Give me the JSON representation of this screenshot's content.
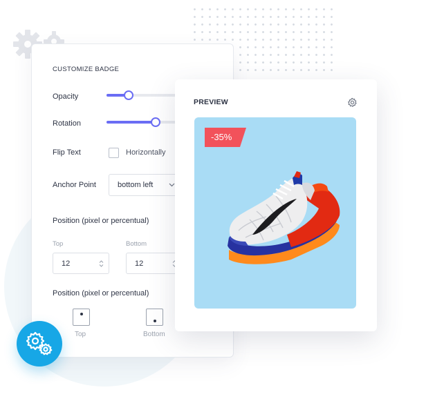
{
  "customize": {
    "title": "CUSTOMIZE BADGE",
    "opacity": {
      "label": "Opacity",
      "value": 0.23
    },
    "rotation": {
      "label": "Rotation",
      "value": 0.51
    },
    "flip_text": {
      "label": "Flip Text",
      "checkbox_label": "Horizontally",
      "checked": false
    },
    "anchor_point": {
      "label": "Anchor Point",
      "selected": "bottom left"
    },
    "position_offsets": {
      "heading": "Position (pixel or percentual)",
      "top": {
        "label": "Top",
        "value": "12"
      },
      "bottom": {
        "label": "Bottom",
        "value": "12"
      }
    },
    "position_buttons": {
      "heading": "Position (pixel or percentual)",
      "top_label": "Top",
      "bottom_label": "Bottom"
    }
  },
  "preview": {
    "title": "PREVIEW",
    "badge_text": "-35%",
    "image_alt": "running-shoe-product-image"
  },
  "colors": {
    "accent": "#6a6df4",
    "badge": "#f2525b",
    "preview_bg": "#a9dcf5",
    "fab": "#17a7e6"
  },
  "icons": {
    "settings": "gear-icon",
    "fab": "gears-icon",
    "select": "chevron-down-icon",
    "stepper": "up-down-arrows-icon"
  }
}
